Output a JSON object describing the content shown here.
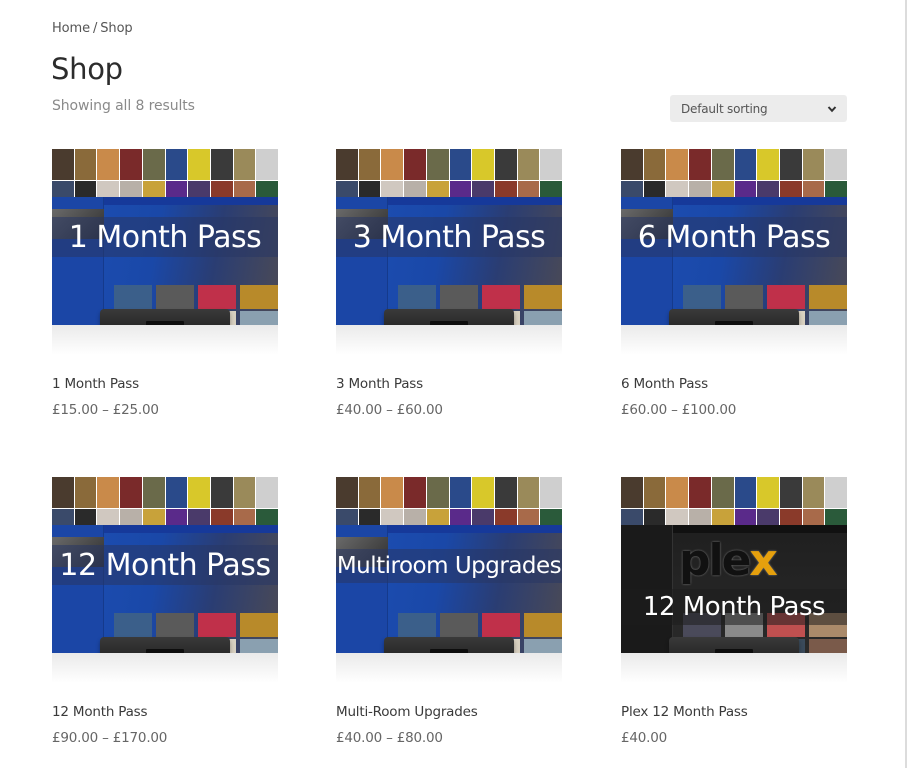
{
  "breadcrumb": {
    "items": [
      "Home",
      "Shop"
    ],
    "separator": "/"
  },
  "page": {
    "title": "Shop",
    "result_count": "Showing all 8 results"
  },
  "sorting": {
    "selected": "Default sorting"
  },
  "products": [
    {
      "name": "1 Month Pass",
      "price": "£15.00 – £25.00",
      "image_text": "1 Month Pass"
    },
    {
      "name": "3 Month Pass",
      "price": "£40.00 – £60.00",
      "image_text": "3 Month Pass"
    },
    {
      "name": "6 Month Pass",
      "price": "£60.00 – £100.00",
      "image_text": "6 Month Pass"
    },
    {
      "name": "12 Month Pass",
      "price": "£90.00 – £170.00",
      "image_text": "12 Month Pass"
    },
    {
      "name": "Multi-Room Upgrades",
      "price": "£40.00 – £80.00",
      "image_text": "Multiroom Upgrades"
    },
    {
      "name": "Plex 12 Month Pass",
      "price": "£40.00",
      "image_text": "12 Month Pass",
      "logo_text": "ple",
      "logo_accent": "x"
    }
  ],
  "colors": {
    "accent_plex": "#e5a00d",
    "tv_blue": "#1d4fb5",
    "sort_bg": "#ececec"
  }
}
